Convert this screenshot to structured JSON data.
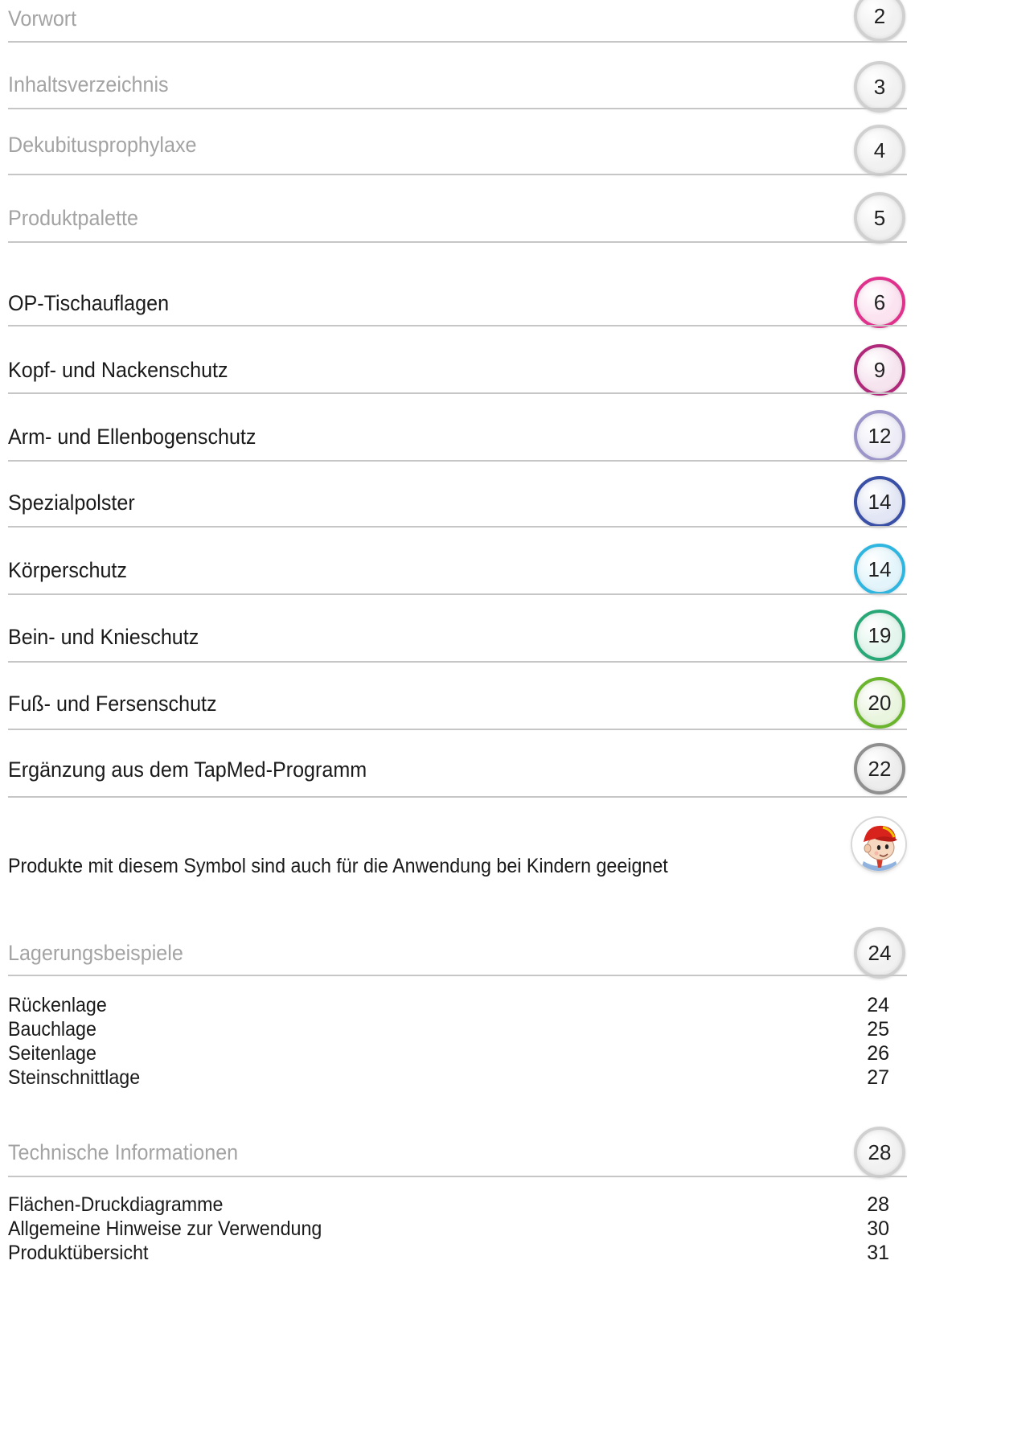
{
  "sections_top": [
    {
      "title": "Vorwort",
      "page": "2",
      "style": "grey",
      "ring": "#d0d0d0",
      "fill": "#f1f1f1"
    },
    {
      "title": "Inhaltsverzeichnis",
      "page": "3",
      "style": "grey",
      "ring": "#d0d0d0",
      "fill": "#f1f1f1"
    },
    {
      "title": "Dekubitusprophylaxe",
      "page": "4",
      "style": "grey",
      "ring": "#d0d0d0",
      "fill": "#f1f1f1"
    },
    {
      "title": "Produktpalette",
      "page": "5",
      "style": "grey",
      "ring": "#d0d0d0",
      "fill": "#f1f1f1"
    }
  ],
  "sections_products": [
    {
      "title": "OP-Tischauflagen",
      "page": "6",
      "style": "dark",
      "ring": "#e0318c",
      "fill": "#fbe3f0"
    },
    {
      "title": "Kopf- und Nackenschutz",
      "page": "9",
      "style": "dark",
      "ring": "#b0287a",
      "fill": "#f6e4ef"
    },
    {
      "title": "Arm- und Ellenbogenschutz",
      "page": "12",
      "style": "dark",
      "ring": "#9b95c9",
      "fill": "#eeedf7"
    },
    {
      "title": "Spezialpolster",
      "page": "14",
      "style": "dark",
      "ring": "#3a4fa6",
      "fill": "#e3e7f5"
    },
    {
      "title": "Körperschutz",
      "page": "14",
      "style": "dark",
      "ring": "#2fb6e0",
      "fill": "#e3f5fb"
    },
    {
      "title": "Bein- und Knieschutz",
      "page": "19",
      "style": "dark",
      "ring": "#27a876",
      "fill": "#e3f5ed"
    },
    {
      "title": "Fuß- und Fersenschutz",
      "page": "20",
      "style": "dark",
      "ring": "#6bb52e",
      "fill": "#eaf5df"
    },
    {
      "title": "Ergänzung aus dem TapMed-Programm",
      "page": "22",
      "style": "dark",
      "ring": "#8f8f8f",
      "fill": "#ededed"
    }
  ],
  "kids_note": "Produkte mit diesem Symbol sind auch für die Anwendung bei Kindern geeignet",
  "kids_icon": "child-face-icon",
  "lagerung": {
    "title": "Lagerungsbeispiele",
    "page": "24",
    "items": [
      {
        "title": "Rückenlage",
        "page": "24"
      },
      {
        "title": "Bauchlage",
        "page": "25"
      },
      {
        "title": "Seitenlage",
        "page": "26"
      },
      {
        "title": "Steinschnittlage",
        "page": "27"
      }
    ]
  },
  "technik": {
    "title": "Technische Informationen",
    "page": "28",
    "items": [
      {
        "title": "Flächen-Druckdiagramme",
        "page": "28"
      },
      {
        "title": "Allgemeine Hinweise zur Verwendung",
        "page": "30"
      },
      {
        "title": "Produktübersicht",
        "page": "31"
      }
    ]
  }
}
